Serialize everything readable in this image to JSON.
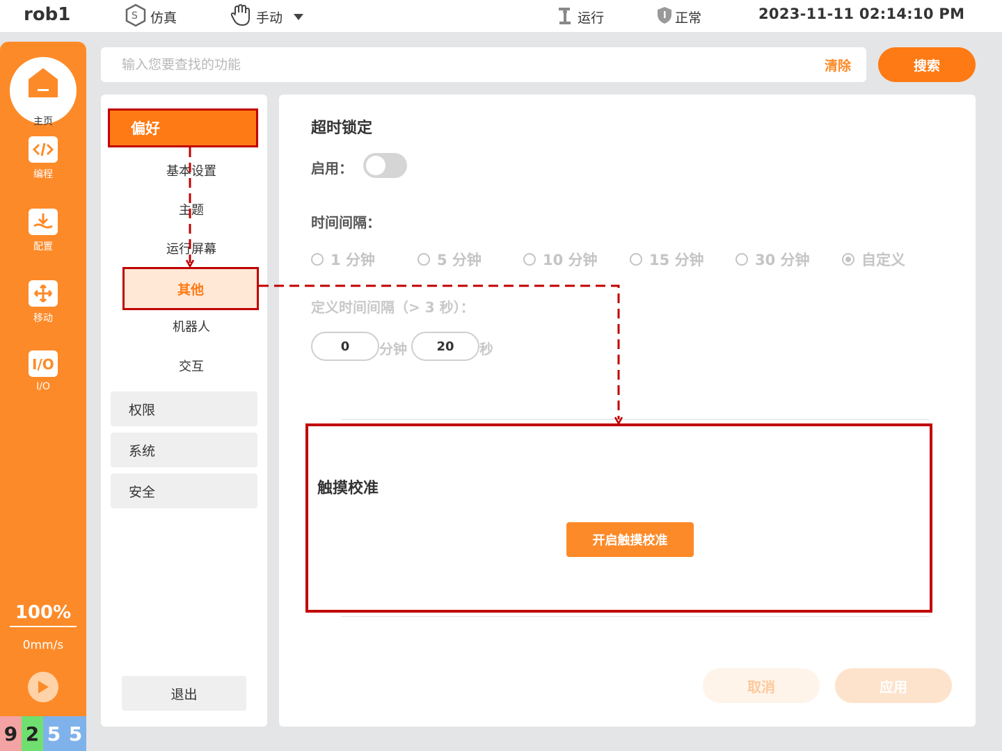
{
  "topbar": {
    "robot_name": "rob1",
    "sim_label": "仿真",
    "mode_label": "手动",
    "run_label": "运行",
    "status_label": "正常",
    "datetime": "2023-11-11 02:14:10 PM"
  },
  "sidebar": {
    "home_label": "主页",
    "items": [
      {
        "label": "编程",
        "icon": "code-icon"
      },
      {
        "label": "配置",
        "icon": "config-download-icon"
      },
      {
        "label": "移动",
        "icon": "move-arrows-icon"
      },
      {
        "label": "I/O",
        "icon": "io-icon"
      }
    ],
    "speed_percent": "100%",
    "speed_mms": "0mm/s",
    "counters": [
      {
        "value": "9",
        "color": "#f3a3a3"
      },
      {
        "value": "2",
        "color": "#6fe06f"
      },
      {
        "value": "5",
        "color": "#7fb2ea"
      },
      {
        "value": "5",
        "color": "#7fb2ea"
      }
    ]
  },
  "search": {
    "placeholder": "输入您要查找的功能",
    "clear_label": "清除",
    "button_label": "搜索"
  },
  "settings_nav": {
    "preferences": "偏好",
    "sub_items": [
      "基本设置",
      "主题",
      "运行屏幕",
      "其他",
      "机器人",
      "交互"
    ],
    "groups": [
      "权限",
      "系统",
      "安全"
    ],
    "exit_label": "退出"
  },
  "content": {
    "timeout_title": "超时锁定",
    "enable_label": "启用：",
    "interval_label": "时间间隔：",
    "interval_options": [
      "1 分钟",
      "5 分钟",
      "10 分钟",
      "15 分钟",
      "30 分钟",
      "自定义"
    ],
    "selected_option": "自定义",
    "custom_label": "定义时间间隔（> 3 秒）：",
    "minutes_value": "0",
    "minutes_unit": "分钟",
    "seconds_value": "20",
    "seconds_unit": "秒",
    "touch_title": "触摸校准",
    "calibrate_button": "开启触摸校准",
    "cancel_button": "取消",
    "apply_button": "应用"
  },
  "colors": {
    "accent": "#fd7a14",
    "sidebar": "#fd8a28",
    "highlight_border": "#c00000"
  }
}
